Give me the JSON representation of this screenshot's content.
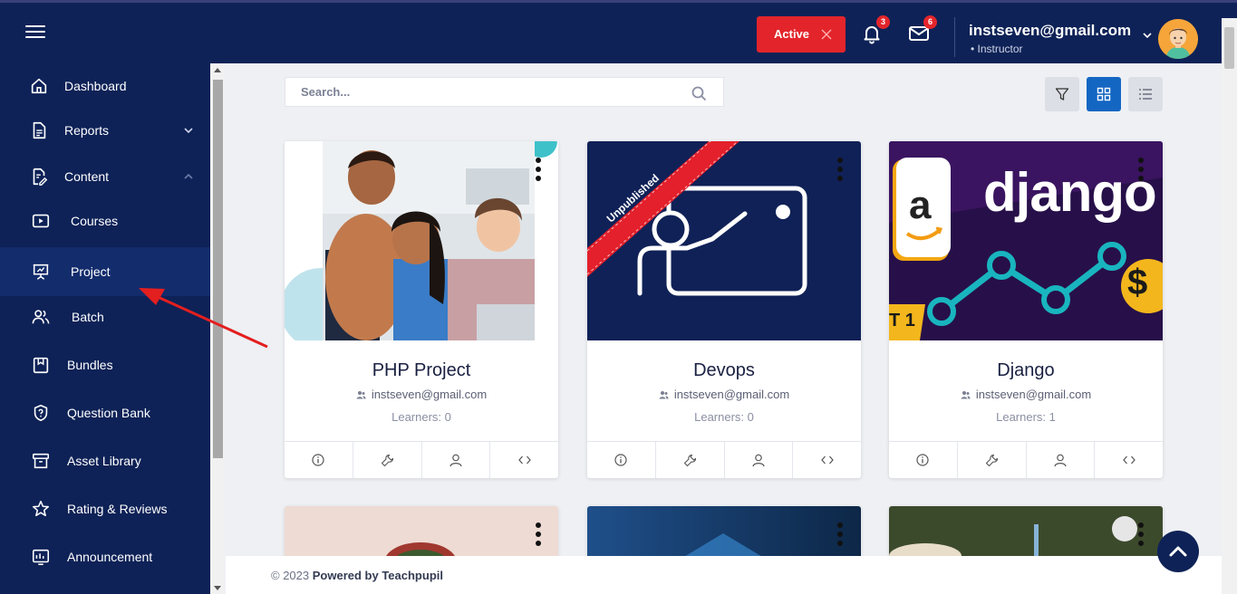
{
  "header": {
    "status_button": "Active",
    "notifications_count": "3",
    "messages_count": "6",
    "user_email": "instseven@gmail.com",
    "user_role": "• Instructor",
    "colors": {
      "bg": "#0e2257",
      "accent": "#e3252b"
    }
  },
  "sidebar": {
    "items": [
      {
        "label": "Dashboard",
        "icon": "home-icon"
      },
      {
        "label": "Reports",
        "icon": "document-icon"
      },
      {
        "label": "Content",
        "icon": "edit-document-icon"
      },
      {
        "label": "Courses",
        "icon": "video-icon"
      },
      {
        "label": "Project",
        "icon": "presentation-icon",
        "selected": true
      },
      {
        "label": "Batch",
        "icon": "users-icon"
      },
      {
        "label": "Bundles",
        "icon": "bundle-icon"
      },
      {
        "label": "Question Bank",
        "icon": "shield-question-icon"
      },
      {
        "label": "Asset Library",
        "icon": "archive-icon"
      },
      {
        "label": "Rating & Reviews",
        "icon": "star-icon"
      },
      {
        "label": "Announcement",
        "icon": "announcement-icon"
      }
    ]
  },
  "search": {
    "placeholder": "Search..."
  },
  "cards": [
    {
      "title": "PHP Project",
      "author": "instseven@gmail.com",
      "learners": "Learners: 0"
    },
    {
      "title": "Devops",
      "author": "instseven@gmail.com",
      "learners": "Learners: 0",
      "ribbon": "Unpublished"
    },
    {
      "title": "Django",
      "author": "instseven@gmail.com",
      "learners": "Learners: 1",
      "image_text": "django",
      "image_side_text": "T 1"
    }
  ],
  "footer": {
    "prefix": "© 2023",
    "powered": "Powered by Teachpupil"
  }
}
